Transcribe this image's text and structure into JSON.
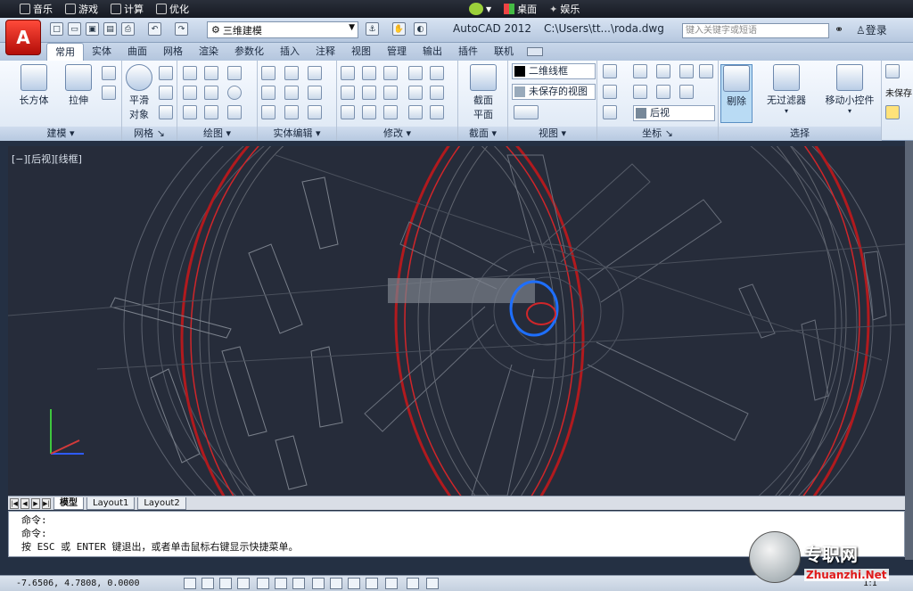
{
  "os_bar": {
    "items": [
      {
        "icon": "music-note-icon",
        "label": "音乐"
      },
      {
        "icon": "gamepad-icon",
        "label": "游戏"
      },
      {
        "icon": "calculator-icon",
        "label": "计算"
      },
      {
        "icon": "wrench-icon",
        "label": "优化"
      }
    ],
    "right_items": [
      {
        "icon": "windows-logo-icon",
        "label": "桌面"
      },
      {
        "icon": "star-icon",
        "label": "娱乐"
      }
    ]
  },
  "title_bar": {
    "workspace": "三维建模",
    "app_title": "AutoCAD 2012",
    "file_title": "C:\\Users\\tt...\\roda.dwg",
    "search_placeholder": "键入关键字或短语",
    "login": "登录"
  },
  "ribbon_tabs": [
    "常用",
    "实体",
    "曲面",
    "网格",
    "渲染",
    "参数化",
    "插入",
    "注释",
    "视图",
    "管理",
    "输出",
    "插件",
    "联机"
  ],
  "ribbon_panels": {
    "modeling": {
      "title": "建模",
      "box": "长方体",
      "extrude": "拉伸"
    },
    "mesh": {
      "title": "网格",
      "smooth_line1": "平滑",
      "smooth_line2": "对象"
    },
    "draw": {
      "title": "绘图"
    },
    "solid_edit": {
      "title": "实体编辑"
    },
    "modify": {
      "title": "修改"
    },
    "section": {
      "title": "截面",
      "label_line1": "截面",
      "label_line2": "平面"
    },
    "view": {
      "title": "视图",
      "visual_style": "二维线框",
      "saved_view": "未保存的视图"
    },
    "coords": {
      "title": "坐标",
      "view_select": "后视"
    },
    "selection": {
      "title": "选择",
      "cull": "剔除",
      "no_filter": "无过滤器",
      "gizmo": "移动小控件"
    },
    "extra": {
      "unsaved": "未保存"
    }
  },
  "viewport": {
    "label": "[−][后视][线框]"
  },
  "layout_tabs": [
    "模型",
    "Layout1",
    "Layout2"
  ],
  "command": {
    "lines": [
      "命令:",
      "命令:",
      "按 ESC 或 ENTER 键退出，或者单击鼠标右键显示快捷菜单。"
    ]
  },
  "status": {
    "coords": "-7.6506,  4.7808, 0.0000",
    "scale": "1:1"
  },
  "watermark": {
    "text": "专职网",
    "url": "Zhuanzhi.Net"
  },
  "colors": {
    "accent_red": "#c0161b",
    "drawing_bg": "#262c3a",
    "wire_gray": "#6a707c",
    "hub_blue": "#1e6fff"
  }
}
